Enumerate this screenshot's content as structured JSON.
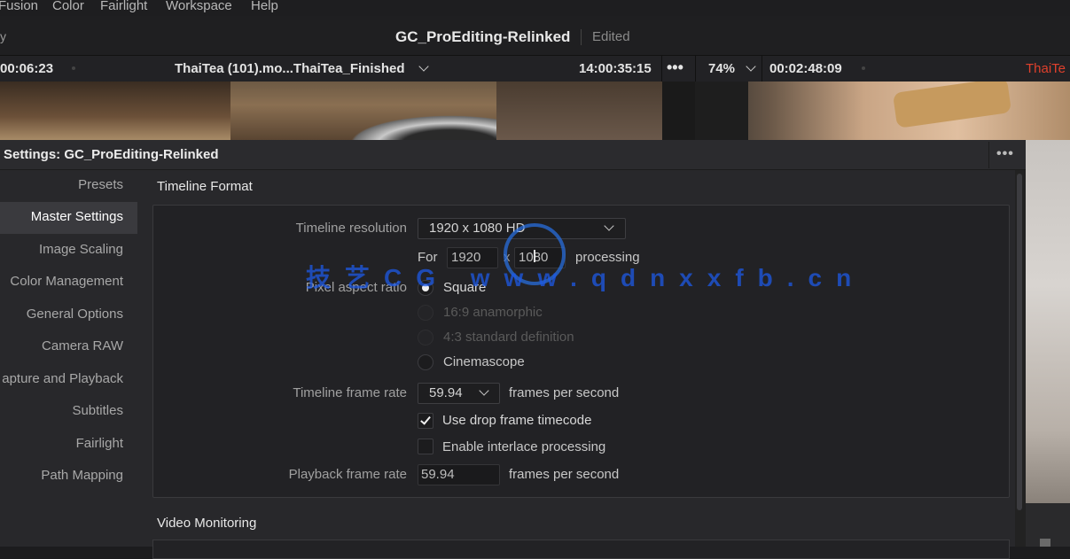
{
  "menu": [
    "Fusion",
    "Color",
    "Fairlight",
    "Workspace",
    "Help"
  ],
  "title_bar": {
    "left_fragment": "y",
    "project_title": "GC_ProEditing-Relinked",
    "status": "Edited"
  },
  "viewer_bar": {
    "source_timecode": "00:06:23",
    "clip_name": "ThaiTea (101).mo...ThaiTea_Finished",
    "record_timecode": "14:00:35:15",
    "zoom": "74%",
    "duration_timecode": "00:02:48:09",
    "timeline_name_fragment": "ThaiTe",
    "timeline_name_color": "#e0402c"
  },
  "dialog": {
    "title": "Settings:  GC_ProEditing-Relinked",
    "sidebar": [
      {
        "label": "Presets",
        "active": false
      },
      {
        "label": "Master Settings",
        "active": true
      },
      {
        "label": "Image Scaling",
        "active": false
      },
      {
        "label": "Color Management",
        "active": false
      },
      {
        "label": "General Options",
        "active": false
      },
      {
        "label": "Camera RAW",
        "active": false
      },
      {
        "label": "apture and Playback",
        "active": false
      },
      {
        "label": "Subtitles",
        "active": false
      },
      {
        "label": "Fairlight",
        "active": false
      },
      {
        "label": "Path Mapping",
        "active": false
      }
    ],
    "timeline_format": {
      "section_title": "Timeline Format",
      "resolution_label": "Timeline resolution",
      "resolution_value": "1920 x 1080 HD",
      "for_label": "For",
      "width": "1920",
      "x_label": "x",
      "height": "1080",
      "processing_label": "processing",
      "pixel_aspect_label": "Pixel aspect ratio",
      "pixel_aspect_options": [
        {
          "label": "Square",
          "selected": true,
          "enabled": true
        },
        {
          "label": "16:9 anamorphic",
          "selected": false,
          "enabled": false
        },
        {
          "label": "4:3 standard definition",
          "selected": false,
          "enabled": false
        },
        {
          "label": "Cinemascope",
          "selected": false,
          "enabled": true
        }
      ],
      "frame_rate_label": "Timeline frame rate",
      "frame_rate_value": "59.94",
      "fps_label": "frames per second",
      "drop_frame_label": "Use drop frame timecode",
      "drop_frame_checked": true,
      "interlace_label": "Enable interlace processing",
      "interlace_checked": false,
      "playback_rate_label": "Playback frame rate",
      "playback_rate_value": "59.94",
      "playback_fps_label": "frames per second"
    },
    "video_monitoring": {
      "section_title": "Video Monitoring"
    }
  },
  "watermark": "技艺CG www.qdnxxfb.cn"
}
